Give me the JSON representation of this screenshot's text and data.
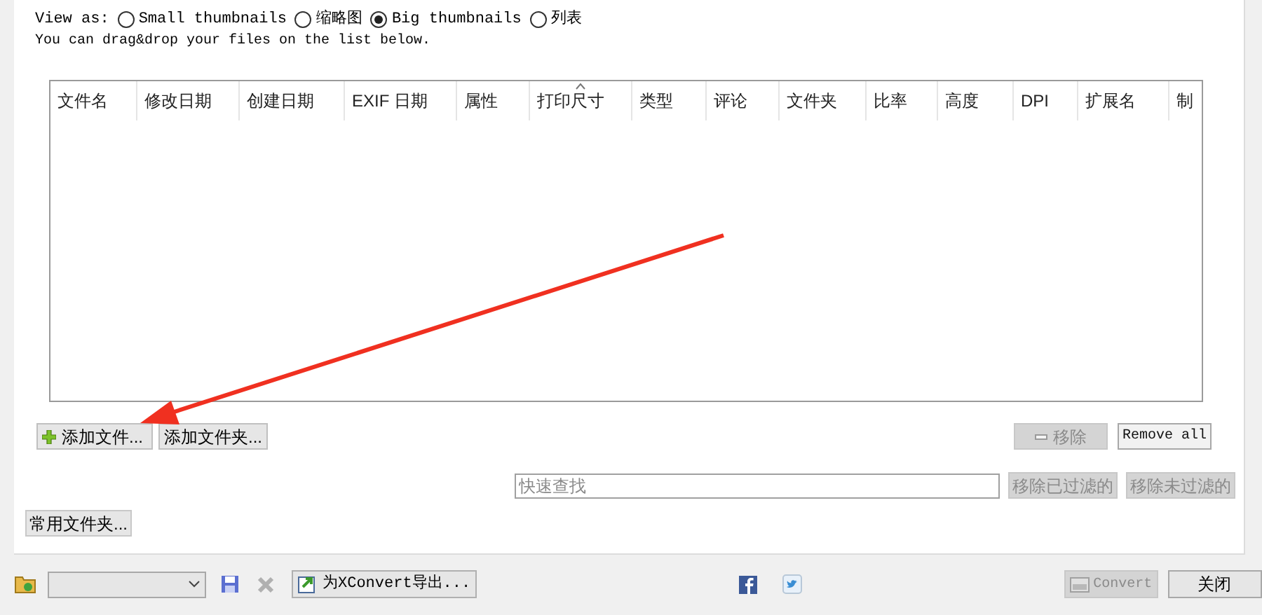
{
  "view_as": {
    "label": "View as:",
    "options": [
      {
        "label": "Small thumbnails",
        "selected": false
      },
      {
        "label": "缩略图",
        "selected": false
      },
      {
        "label": "Big thumbnails",
        "selected": true
      },
      {
        "label": "列表",
        "selected": false
      }
    ]
  },
  "hint": "You can drag&drop your files on the list below.",
  "file_list": {
    "columns": [
      {
        "label": "文件名",
        "sorted": false
      },
      {
        "label": "修改日期",
        "sorted": false
      },
      {
        "label": "创建日期",
        "sorted": false
      },
      {
        "label": "EXIF 日期",
        "sorted": false
      },
      {
        "label": "属性",
        "sorted": false
      },
      {
        "label": "打印尺寸",
        "sorted": true
      },
      {
        "label": "类型",
        "sorted": false
      },
      {
        "label": "评论",
        "sorted": false
      },
      {
        "label": "文件夹",
        "sorted": false
      },
      {
        "label": "比率",
        "sorted": false
      },
      {
        "label": "高度",
        "sorted": false
      },
      {
        "label": "DPI",
        "sorted": false
      },
      {
        "label": "扩展名",
        "sorted": false
      },
      {
        "label": "制",
        "sorted": false
      }
    ]
  },
  "add_buttons": [
    {
      "label": "添加文件...",
      "kind": "add-file"
    },
    {
      "label": "添加文件夹...",
      "kind": "plain"
    }
  ],
  "remove": {
    "label": "移除",
    "disabled": true
  },
  "remove_all": {
    "label": "Remove all",
    "disabled": false
  },
  "quick_search": {
    "placeholder": "快速查找"
  },
  "filter_buttons": [
    {
      "label": "移除已过滤的",
      "disabled": true
    },
    {
      "label": "移除未过滤的",
      "disabled": true
    }
  ],
  "favorites_button": {
    "label": "常用文件夹..."
  },
  "bottom_bar": {
    "export_button": {
      "label": "为XConvert导出..."
    },
    "convert": {
      "label": "Convert",
      "disabled": true
    },
    "close": {
      "label": "关闭"
    }
  }
}
